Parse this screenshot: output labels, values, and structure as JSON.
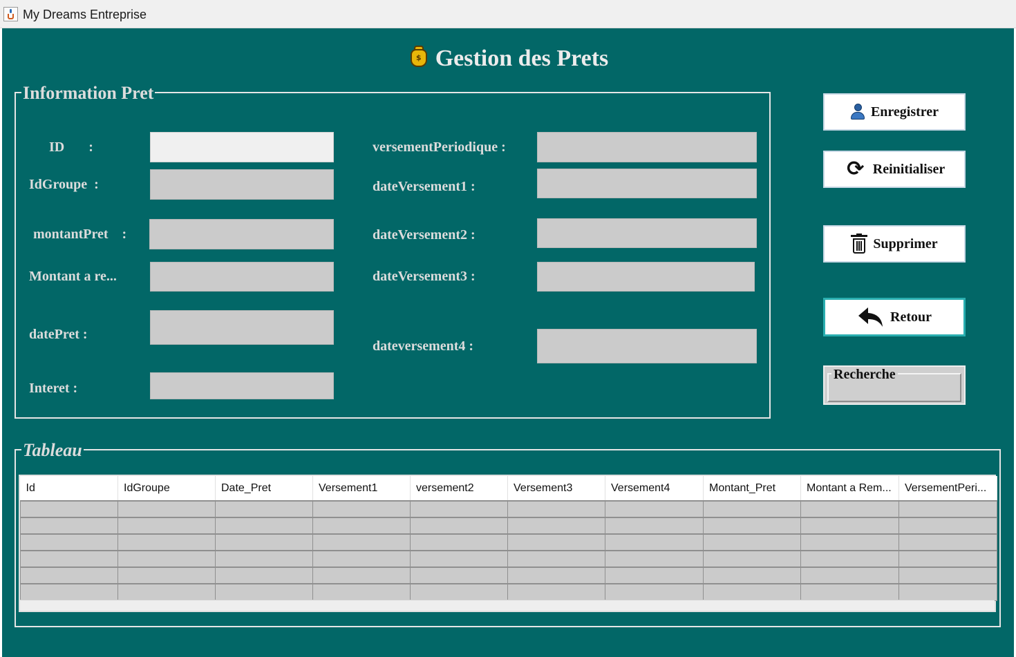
{
  "window": {
    "title": "My Dreams Entreprise"
  },
  "page": {
    "title": "Gestion des Prets"
  },
  "info_group": {
    "legend": "Information Pret",
    "labels": {
      "id": "ID       :",
      "id_groupe": "IdGroupe  :",
      "montant_pret": "montantPret    :",
      "montant_a_rembourser": "Montant a re...",
      "date_pret": "datePret :",
      "interet": "Interet :",
      "versement_periodique": "versementPeriodique :",
      "date_versement1": "dateVersement1 :",
      "date_versement2": "dateVersement2 :",
      "date_versement3": "dateVersement3 :",
      "date_versement4": "dateversement4 :"
    },
    "values": {
      "id": "",
      "id_groupe": "",
      "montant_pret": "",
      "montant_a_rembourser": "",
      "date_pret": "",
      "interet": "",
      "versement_periodique": "",
      "date_versement1": "",
      "date_versement2": "",
      "date_versement3": "",
      "date_versement4": ""
    }
  },
  "buttons": {
    "enregistrer": {
      "label": "Enregistrer",
      "icon": "user-save-icon"
    },
    "reinitialiser": {
      "label": "Reinitialiser",
      "icon": "refresh-icon"
    },
    "supprimer": {
      "label": "Supprimer",
      "icon": "trash-icon"
    },
    "retour": {
      "label": "Retour",
      "icon": "back-arrow-icon"
    }
  },
  "search": {
    "legend": "Recherche",
    "value": ""
  },
  "table": {
    "legend": "Tableau",
    "columns": [
      "Id",
      "IdGroupe",
      "Date_Pret",
      "Versement1",
      "versement2",
      "Versement3",
      "Versement4",
      "Montant_Pret",
      "Montant a Rem...",
      "VersementPeri..."
    ],
    "rows": [
      [
        "",
        "",
        "",
        "",
        "",
        "",
        "",
        "",
        "",
        ""
      ],
      [
        "",
        "",
        "",
        "",
        "",
        "",
        "",
        "",
        "",
        ""
      ],
      [
        "",
        "",
        "",
        "",
        "",
        "",
        "",
        "",
        "",
        ""
      ],
      [
        "",
        "",
        "",
        "",
        "",
        "",
        "",
        "",
        "",
        ""
      ],
      [
        "",
        "",
        "",
        "",
        "",
        "",
        "",
        "",
        "",
        ""
      ],
      [
        "",
        "",
        "",
        "",
        "",
        "",
        "",
        "",
        "",
        ""
      ]
    ]
  },
  "colors": {
    "background": "#026767",
    "field": "#cbcbcb",
    "label": "#dcdcdc",
    "button": "#ffffff"
  }
}
